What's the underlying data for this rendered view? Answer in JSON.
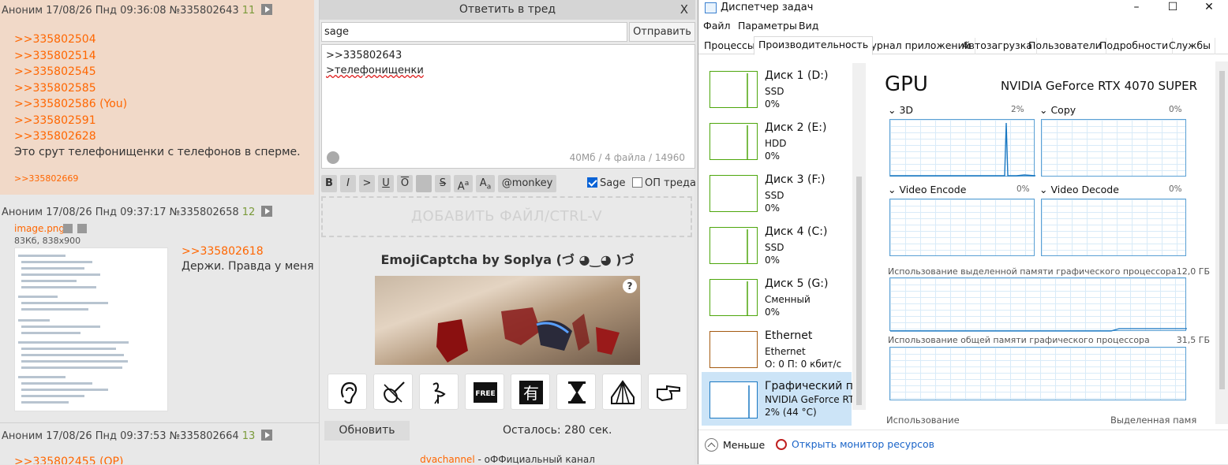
{
  "board": {
    "post1": {
      "header": "Аноним 17/08/26 Пнд 09:36:08 №335802643",
      "count": "11",
      "links": [
        ">>335802504",
        ">>335802514",
        ">>335802545",
        ">>335802585",
        ">>335802586 (You)",
        ">>335802591",
        ">>335802628"
      ],
      "text": "Это срут телефонищенки с телефонов в сперме.",
      "reply_ref": ">>335802669"
    },
    "post2": {
      "header": "Аноним 17/08/26 Пнд 09:37:17 №335802658",
      "count": "12",
      "file_name": "image.png",
      "file_meta": "83Кб, 838x900",
      "link": ">>335802618",
      "text": "Держи. Правда у меня"
    },
    "post3": {
      "header": "Аноним 17/08/26 Пнд 09:37:53 №335802664",
      "count": "13",
      "link": ">>335802455 (OP)"
    }
  },
  "reply_form": {
    "title": "Ответить в тред",
    "close": "X",
    "email_value": "sage",
    "send_label": "Отправить",
    "text_lines": [
      ">>335802643",
      ">телефонищенки"
    ],
    "limits": "40Мб / 4 файла / 14960",
    "toolbar": {
      "bold": "B",
      "italic": "I",
      "quote": ">",
      "underline": "U",
      "overline": "O",
      "spoiler": "",
      "strike": "S",
      "sup": "A",
      "sup_small": "a",
      "sub": "A",
      "sub_small": "a",
      "monkey": "@monkey",
      "sage": "Sage",
      "op": "ОП треда"
    },
    "sage_checked": true,
    "op_checked": false,
    "dropzone": "ДОБАВИТЬ ФАЙЛ/CTRL-V",
    "captcha_title": "EmojiCaptcha by Soplya (づ ◕‿◕ )づ",
    "captcha_help": "?",
    "emoji_icons": [
      "ear-icon",
      "violin-icon",
      "flamingo-icon",
      "free-icon",
      "kanji-have-icon",
      "hourglass-icon",
      "circus-tent-icon",
      "pointing-hand-icon"
    ],
    "free_text": "FREE",
    "kanji_text": "有",
    "refresh_label": "Обновить",
    "remaining": "Осталось: 280 сек.",
    "footer_link": "dvachannel",
    "footer_text": " - оФФициальный канал"
  },
  "task_manager": {
    "title": "Диспетчер задач",
    "window_controls": [
      "–",
      "☐",
      "✕"
    ],
    "menu": [
      "Файл",
      "Параметры",
      "Вид"
    ],
    "tabs": [
      "Процессы",
      "Производительность",
      "Журнал приложений",
      "Автозагрузка",
      "Пользователи",
      "Подробности",
      "Службы"
    ],
    "active_tab": 1,
    "devices": [
      {
        "name": "Диск 1 (D:)",
        "sub1": "SSD",
        "sub2": "0%"
      },
      {
        "name": "Диск 2 (E:)",
        "sub1": "HDD",
        "sub2": "0%"
      },
      {
        "name": "Диск 3 (F:)",
        "sub1": "SSD",
        "sub2": "0%"
      },
      {
        "name": "Диск 4 (C:)",
        "sub1": "SSD",
        "sub2": "0%"
      },
      {
        "name": "Диск 5 (G:)",
        "sub1": "Сменный",
        "sub2": "0%"
      },
      {
        "name": "Ethernet",
        "sub1": "Ethernet",
        "sub2": "О: 0 П: 0 кбит/с"
      },
      {
        "name": "Графический пр",
        "sub1": "NVIDIA GeForce RTX",
        "sub2": "2% (44 °C)"
      }
    ],
    "gpu": {
      "heading": "GPU",
      "model": "NVIDIA GeForce RTX 4070 SUPER",
      "engines": [
        {
          "label": "3D",
          "pct": "2%"
        },
        {
          "label": "Copy",
          "pct": "0%"
        },
        {
          "label": "Video Encode",
          "pct": "0%"
        },
        {
          "label": "Video Decode",
          "pct": "0%"
        }
      ],
      "dedicated_label": "Использование выделенной памяти графического процессора",
      "dedicated_value": "12,0 ГБ",
      "shared_label": "Использование общей памяти графического процессора",
      "shared_value": "31,5 ГБ",
      "bottom_left": "Использование",
      "bottom_right": "Выделенная памя"
    },
    "footer": {
      "less": "Меньше",
      "resmon": "Открыть монитор ресурсов"
    },
    "colors": {
      "disk": "#4da60c",
      "ethernet": "#a45a10",
      "gpu": "#1a78c2",
      "link": "#ff6600"
    }
  }
}
